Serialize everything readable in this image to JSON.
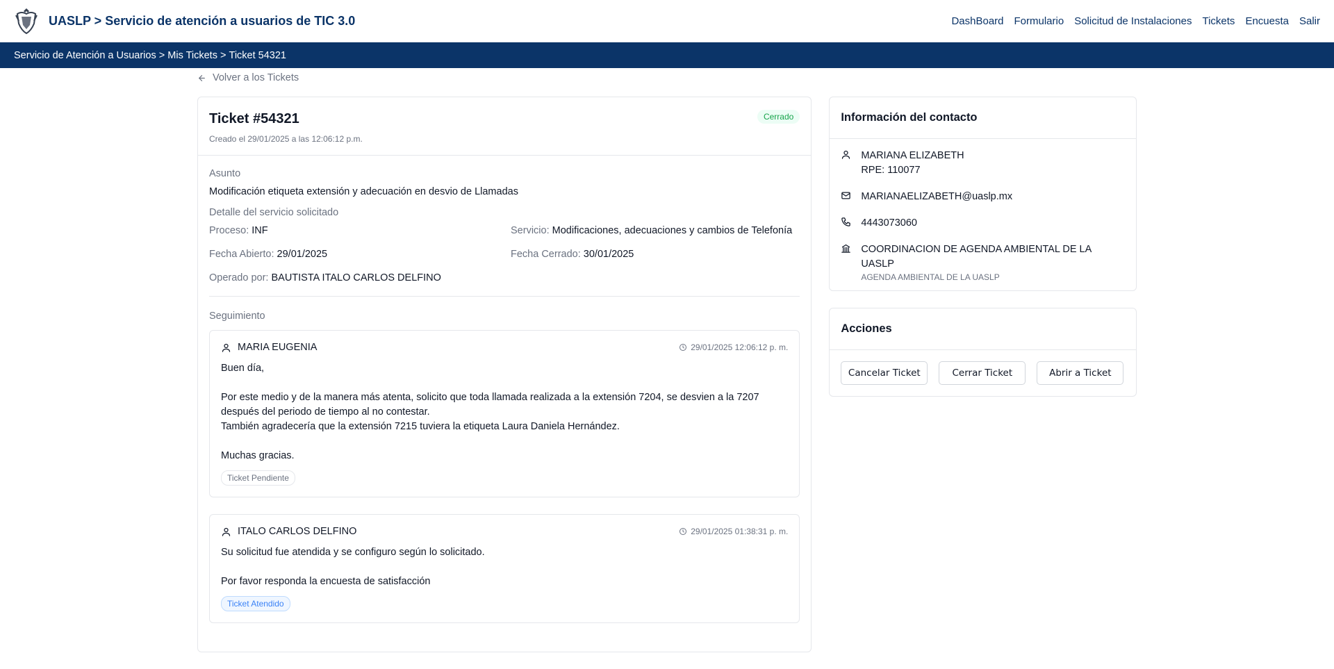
{
  "header": {
    "title": "UASLP > Servicio de atención a usuarios de TIC 3.0",
    "nav": [
      "DashBoard",
      "Formulario",
      "Solicitud de Instalaciones",
      "Tickets",
      "Encuesta",
      "Salir"
    ]
  },
  "breadcrumb": {
    "items": [
      "Servicio de Atención a Usuarios",
      "Mis Tickets",
      "Ticket 54321"
    ],
    "separator": " > "
  },
  "back_link": "Volver a los Tickets",
  "ticket": {
    "title": "Ticket #54321",
    "created": "Creado el 29/01/2025 a las 12:06:12 p.m.",
    "status": "Cerrado",
    "asunto_label": "Asunto",
    "asunto": "Modificación etiqueta extensión y adecuación en desvio de Llamadas",
    "detalle_label": "Detalle del servicio solicitado",
    "proceso_label": "Proceso:",
    "proceso": "INF",
    "servicio_label": "Servicio:",
    "servicio": "Modificaciones, adecuaciones y cambios de Telefonía",
    "fecha_abierto_label": "Fecha Abierto:",
    "fecha_abierto": "29/01/2025",
    "fecha_cerrado_label": "Fecha Cerrado:",
    "fecha_cerrado": "30/01/2025",
    "operado_label": "Operado por:",
    "operado": "BAUTISTA ITALO CARLOS DELFINO",
    "seguimiento_label": "Seguimiento"
  },
  "followups": [
    {
      "author": "MARIA EUGENIA",
      "time": "29/01/2025 12:06:12 p. m.",
      "message": "Buen día,\n\nPor este medio y de la manera más atenta, solicito que toda llamada realizada a la extensión 7204, se desvien a la 7207 después del periodo de tiempo al no contestar.\nTambién agradecería que la extensión 7215 tuviera la etiqueta Laura Daniela Hernández.\n\nMuchas gracias.",
      "status": "Ticket Pendiente"
    },
    {
      "author": "ITALO CARLOS DELFINO",
      "time": "29/01/2025 01:38:31 p. m.",
      "message": "Su solicitud fue atendida y se configuro según lo solicitado.\n\nPor favor responda la encuesta de satisfacción",
      "status": "Ticket Atendido"
    }
  ],
  "contact": {
    "title": "Información del contacto",
    "name": "MARIANA ELIZABETH",
    "rpe": "RPE: 110077",
    "email": "MARIANAELIZABETH@uaslp.mx",
    "phone": "4443073060",
    "department": "COORDINACION DE AGENDA AMBIENTAL DE LA UASLP",
    "department_sub": "AGENDA AMBIENTAL DE LA UASLP"
  },
  "actions": {
    "title": "Acciones",
    "buttons": [
      "Cancelar Ticket",
      "Cerrar Ticket",
      "Abrir a Ticket"
    ]
  },
  "colors": {
    "primary": "#0b3468",
    "closed_badge": "#16a34a",
    "attended_chip": "#3b82f6"
  },
  "icons": [
    "uaslp-logo",
    "arrow-left-icon",
    "user-icon",
    "clock-icon",
    "mail-icon",
    "phone-icon",
    "building-icon"
  ]
}
